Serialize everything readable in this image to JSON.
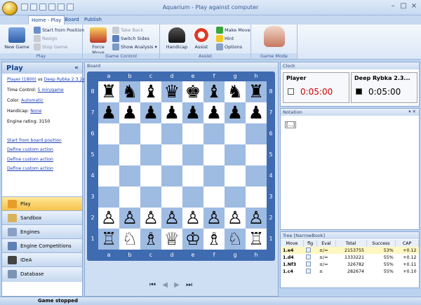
{
  "window": {
    "title": "Aquarium - Play against computer"
  },
  "tabs": [
    "Home - Play",
    "Board",
    "Publish"
  ],
  "ribbon": {
    "new_game": "New Game",
    "start_from_position": "Start from Position",
    "resign": "Resign",
    "stop_game": "Stop Game",
    "group_play": "Play",
    "force_move": "Force Move",
    "take_back": "Take Back",
    "switch_sides": "Switch Sides",
    "show_analysis": "Show Analysis",
    "group_game_control": "Game Control",
    "handicap": "Handicap",
    "assist": "Assist",
    "make_move": "Make Move",
    "hint": "Hint",
    "options": "Options",
    "group_assist": "Assist",
    "group_game_mode": "Game Mode"
  },
  "left": {
    "title": "Play",
    "player": "Player (1800)",
    "vs": "vs",
    "engine_link": "Deep Rybka 2.3.2a x",
    "time_control_label": "Time Control:",
    "time_control": "5 min/game",
    "color_label": "Color:",
    "color": "Automatic",
    "handicap_label": "Handicap:",
    "handicap": "None",
    "engine_rating": "Engine rating: 3150",
    "links": [
      "Start from board position",
      "Define custom action",
      "Define custom action",
      "Define custom action"
    ],
    "nav": [
      "Play",
      "Sandbox",
      "Engines",
      "Engine Competitions",
      "IDeA",
      "Database"
    ]
  },
  "board": {
    "header": "Board",
    "files": [
      "a",
      "b",
      "c",
      "d",
      "e",
      "f",
      "g",
      "h"
    ],
    "ranks": [
      "8",
      "7",
      "6",
      "5",
      "4",
      "3",
      "2",
      "1"
    ],
    "position": [
      "♜♞♝♛♚♝♞♜",
      "♟♟♟♟♟♟♟♟",
      "        ",
      "        ",
      "        ",
      "        ",
      "♙♙♙♙♙♙♙♙",
      "♖♘♗♕♔♗♘♖"
    ],
    "nav_buttons": [
      "⏮",
      "◀",
      "▶",
      "⏭"
    ]
  },
  "clock": {
    "header": "Clock",
    "white_name": "Player",
    "white_time": "0:05:00",
    "black_name": "Deep Rybka 2.3...",
    "black_time": "0:05:00"
  },
  "notation": {
    "header": "Notation",
    "content": "[...]"
  },
  "tree": {
    "header": "Tree [NarrowBook]",
    "columns": [
      "Move",
      "flg",
      "Eval",
      "Total",
      "Success",
      "CAP"
    ],
    "rows": [
      {
        "move": "1.e4",
        "eval": "±/=",
        "total": "2153755",
        "success": "53%",
        "cap": "+0.12"
      },
      {
        "move": "1.d4",
        "eval": "±/=",
        "total": "1333221",
        "success": "55%",
        "cap": "+0.12"
      },
      {
        "move": "1.Nf3",
        "eval": "±/=",
        "total": "326782",
        "success": "55%",
        "cap": "+0.11"
      },
      {
        "move": "1.c4",
        "eval": "±",
        "total": "282674",
        "success": "55%",
        "cap": "+0.10"
      }
    ]
  },
  "status": {
    "text": "Game stopped"
  },
  "colors": {
    "accent": "#15428b",
    "clock_time": "#d40000",
    "dark_square": "#9ebbe2",
    "board_frame": "#3f6bb0"
  }
}
